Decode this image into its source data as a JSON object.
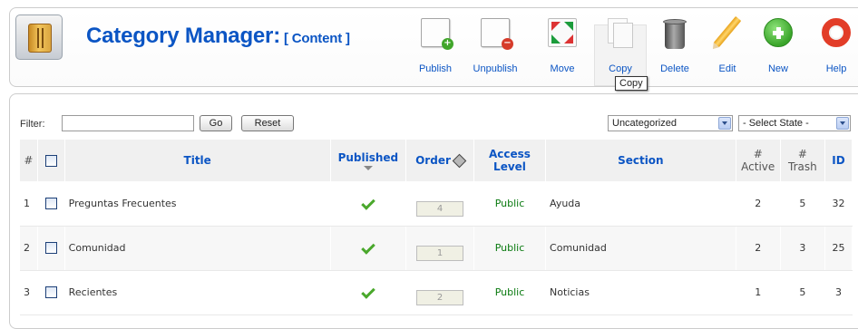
{
  "header": {
    "title": "Category Manager:",
    "subtitle": "[ Content ]"
  },
  "toolbar": {
    "buttons": [
      {
        "label": "Publish",
        "icon": "publish-icon"
      },
      {
        "label": "Unpublish",
        "icon": "unpublish-icon"
      },
      {
        "label": "Move",
        "icon": "move-icon"
      },
      {
        "label": "Copy",
        "icon": "copy-icon"
      },
      {
        "label": "Delete",
        "icon": "trash-icon"
      },
      {
        "label": "Edit",
        "icon": "pencil-icon"
      },
      {
        "label": "New",
        "icon": "plus-icon"
      },
      {
        "label": "Help",
        "icon": "lifebuoy-icon"
      }
    ],
    "tooltip": "Copy"
  },
  "filter": {
    "label": "Filter:",
    "value": "",
    "go_label": "Go",
    "reset_label": "Reset",
    "section_select": "Uncategorized",
    "state_select": "- Select State -"
  },
  "table": {
    "columns": {
      "num": "#",
      "title": "Title",
      "published": "Published",
      "order": "Order",
      "access_1": "Access",
      "access_2": "Level",
      "section": "Section",
      "active_1": "#",
      "active_2": "Active",
      "trash_1": "#",
      "trash_2": "Trash",
      "id": "ID"
    },
    "rows": [
      {
        "num": "1",
        "title": "Preguntas Frecuentes",
        "order": "4",
        "access": "Public",
        "section": "Ayuda",
        "active": "2",
        "trash": "5",
        "id": "32"
      },
      {
        "num": "2",
        "title": "Comunidad",
        "order": "1",
        "access": "Public",
        "section": "Comunidad",
        "active": "2",
        "trash": "3",
        "id": "25"
      },
      {
        "num": "3",
        "title": "Recientes",
        "order": "2",
        "access": "Public",
        "section": "Noticias",
        "active": "1",
        "trash": "5",
        "id": "3"
      }
    ]
  },
  "colors": {
    "link": "#0b55c4",
    "published_check": "#4aa82c"
  }
}
